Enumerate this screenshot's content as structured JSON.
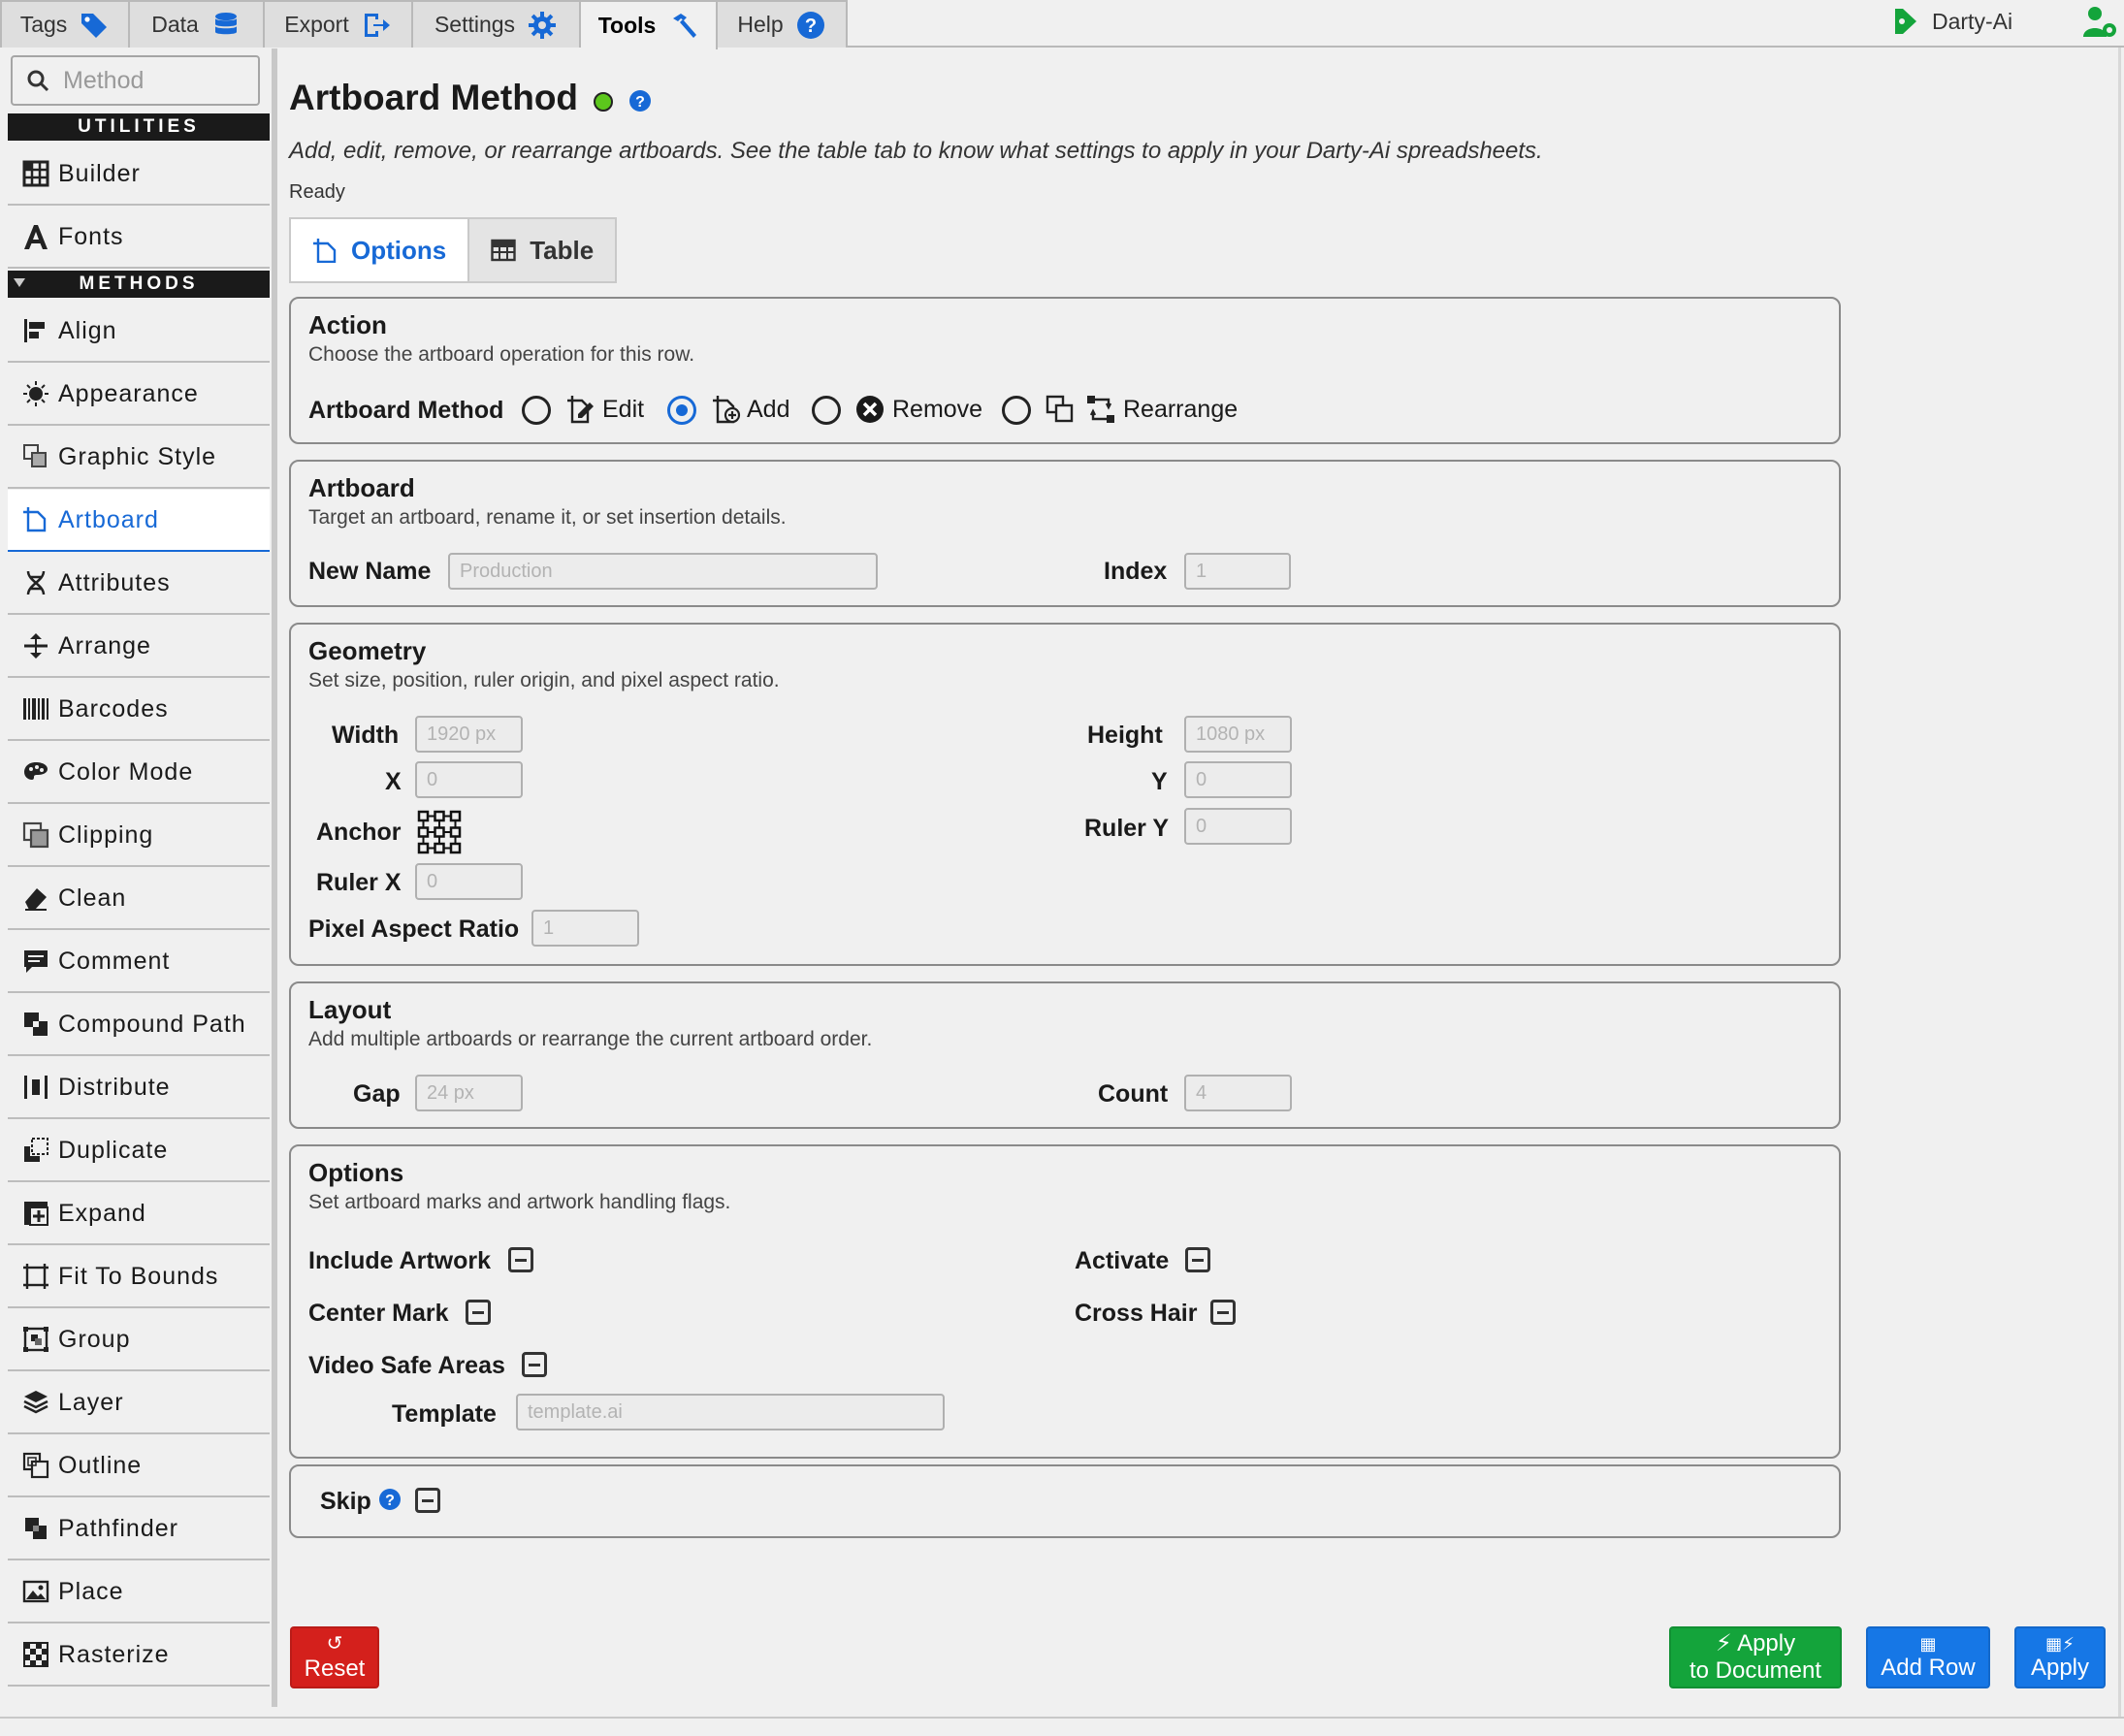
{
  "top_tabs": [
    {
      "label": "Tags",
      "icon": "tag-icon"
    },
    {
      "label": "Data",
      "icon": "database-icon"
    },
    {
      "label": "Export",
      "icon": "export-icon"
    },
    {
      "label": "Settings",
      "icon": "gear-icon"
    },
    {
      "label": "Tools",
      "icon": "hammer-icon",
      "active": true
    },
    {
      "label": "Help",
      "icon": "help-icon"
    }
  ],
  "user": {
    "name": "Darty-Ai"
  },
  "sidebar": {
    "search_placeholder": "Method",
    "utilities_heading": "UTILITIES",
    "methods_heading": "METHODS",
    "utilities": [
      {
        "label": "Builder",
        "icon": "table-grid-icon"
      },
      {
        "label": "Fonts",
        "icon": "font-a-icon"
      }
    ],
    "methods": [
      {
        "label": "Align",
        "icon": "align-left-icon"
      },
      {
        "label": "Appearance",
        "icon": "sun-icon"
      },
      {
        "label": "Graphic Style",
        "icon": "graphic-style-icon"
      },
      {
        "label": "Artboard",
        "icon": "artboard-icon",
        "active": true
      },
      {
        "label": "Attributes",
        "icon": "dna-icon"
      },
      {
        "label": "Arrange",
        "icon": "arrange-icon"
      },
      {
        "label": "Barcodes",
        "icon": "barcode-icon"
      },
      {
        "label": "Color Mode",
        "icon": "palette-icon"
      },
      {
        "label": "Clipping",
        "icon": "clipping-icon"
      },
      {
        "label": "Clean",
        "icon": "eraser-icon"
      },
      {
        "label": "Comment",
        "icon": "comment-icon"
      },
      {
        "label": "Compound Path",
        "icon": "compound-path-icon"
      },
      {
        "label": "Distribute",
        "icon": "distribute-icon"
      },
      {
        "label": "Duplicate",
        "icon": "duplicate-icon"
      },
      {
        "label": "Expand",
        "icon": "expand-icon"
      },
      {
        "label": "Fit To Bounds",
        "icon": "fit-bounds-icon"
      },
      {
        "label": "Group",
        "icon": "group-icon"
      },
      {
        "label": "Layer",
        "icon": "layers-icon"
      },
      {
        "label": "Outline",
        "icon": "outline-icon"
      },
      {
        "label": "Pathfinder",
        "icon": "pathfinder-icon"
      },
      {
        "label": "Place",
        "icon": "image-icon"
      },
      {
        "label": "Rasterize",
        "icon": "checker-icon"
      }
    ]
  },
  "main": {
    "title": "Artboard Method",
    "description": "Add, edit, remove, or rearrange artboards. See the table tab to know what settings to apply in your Darty-Ai spreadsheets.",
    "status": "Ready",
    "status_color": "#5cc71c",
    "subtabs": [
      {
        "label": "Options",
        "icon": "artboard-icon",
        "active": true
      },
      {
        "label": "Table",
        "icon": "table-icon"
      }
    ],
    "action": {
      "title": "Action",
      "desc": "Choose the artboard operation for this row.",
      "method_label": "Artboard Method",
      "options": [
        {
          "label": "Edit",
          "icon": "edit-artboard-icon",
          "selected": false
        },
        {
          "label": "Add",
          "icon": "add-artboard-icon",
          "selected": true
        },
        {
          "label": "Remove",
          "icon": "remove-circle-icon",
          "selected": false
        },
        {
          "label": "Rearrange",
          "icon": "rearrange-icon",
          "selected": false
        }
      ]
    },
    "artboard": {
      "title": "Artboard",
      "desc": "Target an artboard, rename it, or set insertion details.",
      "new_name_label": "New Name",
      "new_name_placeholder": "Production",
      "index_label": "Index",
      "index_placeholder": "1"
    },
    "geometry": {
      "title": "Geometry",
      "desc": "Set size, position, ruler origin, and pixel aspect ratio.",
      "width_label": "Width",
      "width_placeholder": "1920 px",
      "height_label": "Height",
      "height_placeholder": "1080 px",
      "x_label": "X",
      "x_placeholder": "0",
      "y_label": "Y",
      "y_placeholder": "0",
      "anchor_label": "Anchor",
      "ruler_y_label": "Ruler Y",
      "ruler_y_placeholder": "0",
      "ruler_x_label": "Ruler X",
      "ruler_x_placeholder": "0",
      "par_label": "Pixel Aspect Ratio",
      "par_placeholder": "1"
    },
    "layout": {
      "title": "Layout",
      "desc": "Add multiple artboards or rearrange the current artboard order.",
      "gap_label": "Gap",
      "gap_placeholder": "24 px",
      "count_label": "Count",
      "count_placeholder": "4"
    },
    "options": {
      "title": "Options",
      "desc": "Set artboard marks and artwork handling flags.",
      "include_artwork": "Include Artwork",
      "activate": "Activate",
      "center_mark": "Center Mark",
      "cross_hair": "Cross Hair",
      "video_safe": "Video Safe Areas",
      "template_label": "Template",
      "template_placeholder": "template.ai"
    },
    "skip": {
      "label": "Skip"
    },
    "buttons": {
      "reset": "Reset",
      "apply_doc_1": "Apply",
      "apply_doc_2": "to Document",
      "add_row": "Add Row",
      "apply": "Apply"
    },
    "colors": {
      "accent": "#1769d6",
      "reset": "#d4201c",
      "apply_doc": "#14a43b",
      "add_row": "#1677e6"
    }
  }
}
